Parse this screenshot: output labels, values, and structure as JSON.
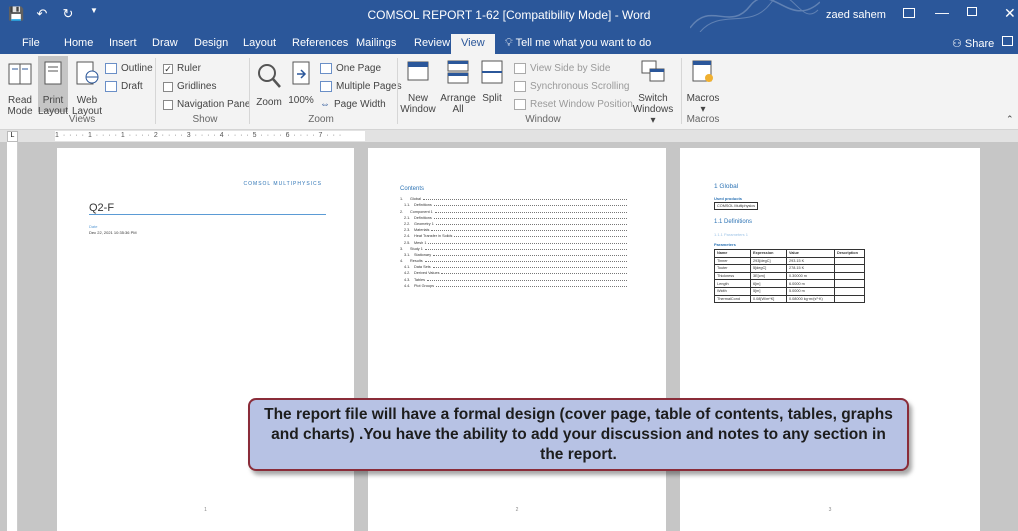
{
  "window": {
    "title": "COMSOL REPORT 1-62 [Compatibility Mode] - Word",
    "user": "zaed sahem",
    "qat": [
      "💾",
      "↶",
      "↻",
      "▼"
    ]
  },
  "tabs": [
    "File",
    "Home",
    "Insert",
    "Draw",
    "Design",
    "Layout",
    "References",
    "Mailings",
    "Review",
    "View"
  ],
  "active_tab": "View",
  "tell_me": "Tell me what you want to do",
  "share": "Share",
  "ribbon": {
    "views": {
      "read_mode": [
        "Read",
        "Mode"
      ],
      "print_layout": [
        "Print",
        "Layout"
      ],
      "web_layout": [
        "Web",
        "Layout"
      ],
      "outline": "Outline",
      "draft": "Draft",
      "label": "Views"
    },
    "show": {
      "ruler": "Ruler",
      "gridlines": "Gridlines",
      "navigation_pane": "Navigation Pane",
      "label": "Show"
    },
    "zoom": {
      "zoom": "Zoom",
      "percent": "100%",
      "one_page": "One Page",
      "multiple_pages": "Multiple Pages",
      "page_width": "Page Width",
      "label": "Zoom"
    },
    "window": {
      "new_window": [
        "New",
        "Window"
      ],
      "arrange_all": [
        "Arrange",
        "All"
      ],
      "split": "Split",
      "view_side_by_side": "View Side by Side",
      "sync_scrolling": "Synchronous Scrolling",
      "reset_position": "Reset Window Position",
      "switch_windows": [
        "Switch",
        "Windows ▾"
      ],
      "label": "Window"
    },
    "macros": {
      "macros": "Macros",
      "label": "Macros"
    }
  },
  "ruler_text": "1 · · · · 1 · · · · 1 · · · · 2 · · · · 3 · · · · 4 · · · · 5 · · · · 6 · · · · 7 · · ·",
  "page1": {
    "logo": "COMSOL MULTIPHYSICS",
    "title": "Q2-F",
    "date_label": "Date",
    "date_value": "Dec 22, 2021 10:35:36 PM",
    "page_number": "1"
  },
  "page2": {
    "toc_title": "Contents",
    "toc": [
      [
        "1.",
        "Global"
      ],
      [
        "1.1.",
        "Definitions"
      ],
      [
        "2.",
        "Component 1"
      ],
      [
        "2.1.",
        "Definitions"
      ],
      [
        "2.2.",
        "Geometry 1"
      ],
      [
        "2.3.",
        "Materials"
      ],
      [
        "2.4.",
        "Heat Transfer in Solids"
      ],
      [
        "2.5.",
        "Mesh 1"
      ],
      [
        "3.",
        "Study 1"
      ],
      [
        "3.1.",
        "Stationary"
      ],
      [
        "4.",
        "Results"
      ],
      [
        "4.1.",
        "Data Sets"
      ],
      [
        "4.2.",
        "Derived Values"
      ],
      [
        "4.3.",
        "Tables"
      ],
      [
        "4.4.",
        "Plot Groups"
      ]
    ],
    "page_number": "2"
  },
  "page3": {
    "heading": "1   Global",
    "used_products": "Used products",
    "product": "COMSOL Multiphysics",
    "definitions": "1.1   Definitions",
    "sub": "1.1.1   Parameters 1",
    "parameters": "Parameters",
    "columns": [
      "Name",
      "Expression",
      "Value",
      "Description"
    ],
    "rows": [
      [
        "Tinner",
        "293[degC]",
        "293.15 K",
        ""
      ],
      [
        "Touter",
        "5[degC]",
        "278.15 K",
        ""
      ],
      [
        "Thickness",
        "3E[cm]",
        "0.30000 m",
        ""
      ],
      [
        "Length",
        "6[m]",
        "6.0000 m",
        ""
      ],
      [
        "Width",
        "5[m]",
        "5.0000 m",
        ""
      ],
      [
        "ThermalCond",
        "0.08[W/m*K]",
        "0.08000 kg·m/(s³·K)",
        ""
      ]
    ],
    "page_number": "3"
  },
  "callout": "The report file will have a formal design (cover page, table of contents, tables, graphs and charts) .You have the ability to add your discussion and notes to any section in the report."
}
